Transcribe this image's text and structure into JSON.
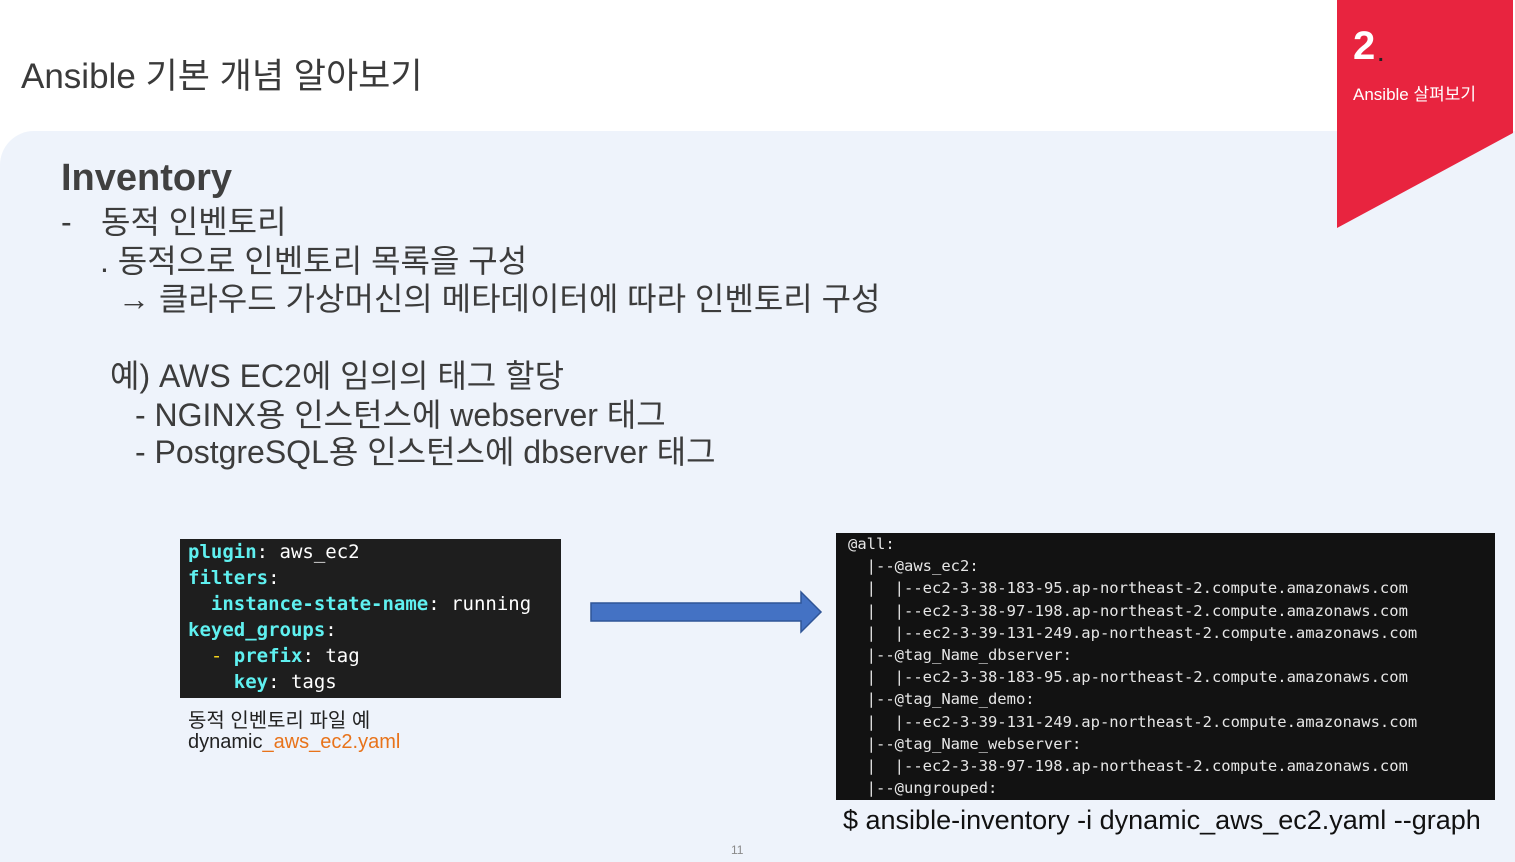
{
  "header": {
    "title": "Ansible 기본 개념 알아보기"
  },
  "badge": {
    "number": "2",
    "dot": ".",
    "label": "Ansible 살펴보기",
    "color": "#e8243f"
  },
  "content": {
    "heading": "Inventory",
    "bullet_dash": "-",
    "bullet_text": "동적 인벤토리",
    "line2": ". 동적으로 인벤토리 목록을 구성",
    "line3": "→ 클라우드 가상머신의 메타데이터에 따라 인벤토리 구성",
    "example_title": "예) AWS EC2에 임의의 태그 할당",
    "example_1": "- NGINX용 인스턴스에 webserver 태그",
    "example_2": "- PostgreSQL용 인스턴스에 dbserver 태그"
  },
  "code": {
    "lines": [
      [
        {
          "t": "plugin",
          "k": 1
        },
        {
          "t": ": aws_ec2"
        }
      ],
      [
        {
          "t": "filters",
          "k": 1
        },
        {
          "t": ":"
        }
      ],
      [
        {
          "t": "  "
        },
        {
          "t": "instance-state-name",
          "k": 1
        },
        {
          "t": ": running"
        }
      ],
      [
        {
          "t": "keyed_groups",
          "k": 1
        },
        {
          "t": ":"
        }
      ],
      [
        {
          "t": "  "
        },
        {
          "t": "-",
          "y": 1
        },
        {
          "t": " "
        },
        {
          "t": "prefix",
          "k": 1
        },
        {
          "t": ": tag"
        }
      ],
      [
        {
          "t": "    "
        },
        {
          "t": "key",
          "k": 1
        },
        {
          "t": ": tags"
        }
      ]
    ],
    "caption_1": "동적 인벤토리 파일 예",
    "caption_2_prefix": "dynamic",
    "caption_2_highlight": "_aws_ec2.yaml",
    "caption_highlight_color": "#e8731a"
  },
  "arrow": {
    "color": "#3f6fc6"
  },
  "terminal": {
    "lines": [
      "@all:",
      "  |--@aws_ec2:",
      "  |  |--ec2-3-38-183-95.ap-northeast-2.compute.amazonaws.com",
      "  |  |--ec2-3-38-97-198.ap-northeast-2.compute.amazonaws.com",
      "  |  |--ec2-3-39-131-249.ap-northeast-2.compute.amazonaws.com",
      "  |--@tag_Name_dbserver:",
      "  |  |--ec2-3-38-183-95.ap-northeast-2.compute.amazonaws.com",
      "  |--@tag_Name_demo:",
      "  |  |--ec2-3-39-131-249.ap-northeast-2.compute.amazonaws.com",
      "  |--@tag_Name_webserver:",
      "  |  |--ec2-3-38-97-198.ap-northeast-2.compute.amazonaws.com",
      "  |--@ungrouped:"
    ],
    "command": "$ ansible-inventory -i dynamic_aws_ec2.yaml --graph"
  },
  "page_number": "11"
}
